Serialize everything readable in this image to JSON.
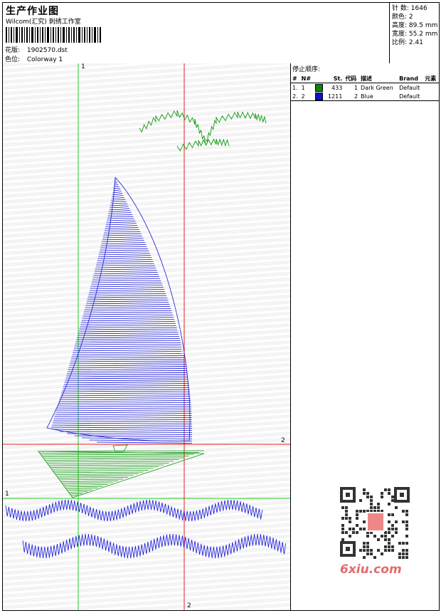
{
  "header": {
    "title": "生产作业图",
    "company": "Wilcom(汇究) 刺绣工作室",
    "design_label": "花版:",
    "design_file": "1902570.dst",
    "colorway_label": "色位:",
    "colorway": "Colorway 1"
  },
  "stats": [
    {
      "label": "针 数:",
      "value": "1646"
    },
    {
      "label": "颜色:",
      "value": "2"
    },
    {
      "label": "高度:",
      "value": "89.5 mm"
    },
    {
      "label": "宽度:",
      "value": "55.2 mm"
    },
    {
      "label": "比例:",
      "value": "2.41"
    }
  ],
  "stop_sequence": {
    "title": "停止顺序:",
    "columns": [
      "#",
      "N#",
      "",
      "St.",
      "代码",
      "描述",
      "Brand",
      "元素"
    ],
    "rows": [
      {
        "idx": "1.",
        "n": "1",
        "color": "#108010",
        "stitches": "433",
        "code": "1",
        "desc": "Dark Green",
        "brand": "Default"
      },
      {
        "idx": "2.",
        "n": "2",
        "color": "#1010d0",
        "stitches": "1211",
        "code": "2",
        "desc": "Blue",
        "brand": "Default"
      }
    ]
  },
  "axes": {
    "green_top": "1",
    "green_left": "1",
    "red_right": "2",
    "red_bottom": "2"
  },
  "watermark": "6xiu.com"
}
